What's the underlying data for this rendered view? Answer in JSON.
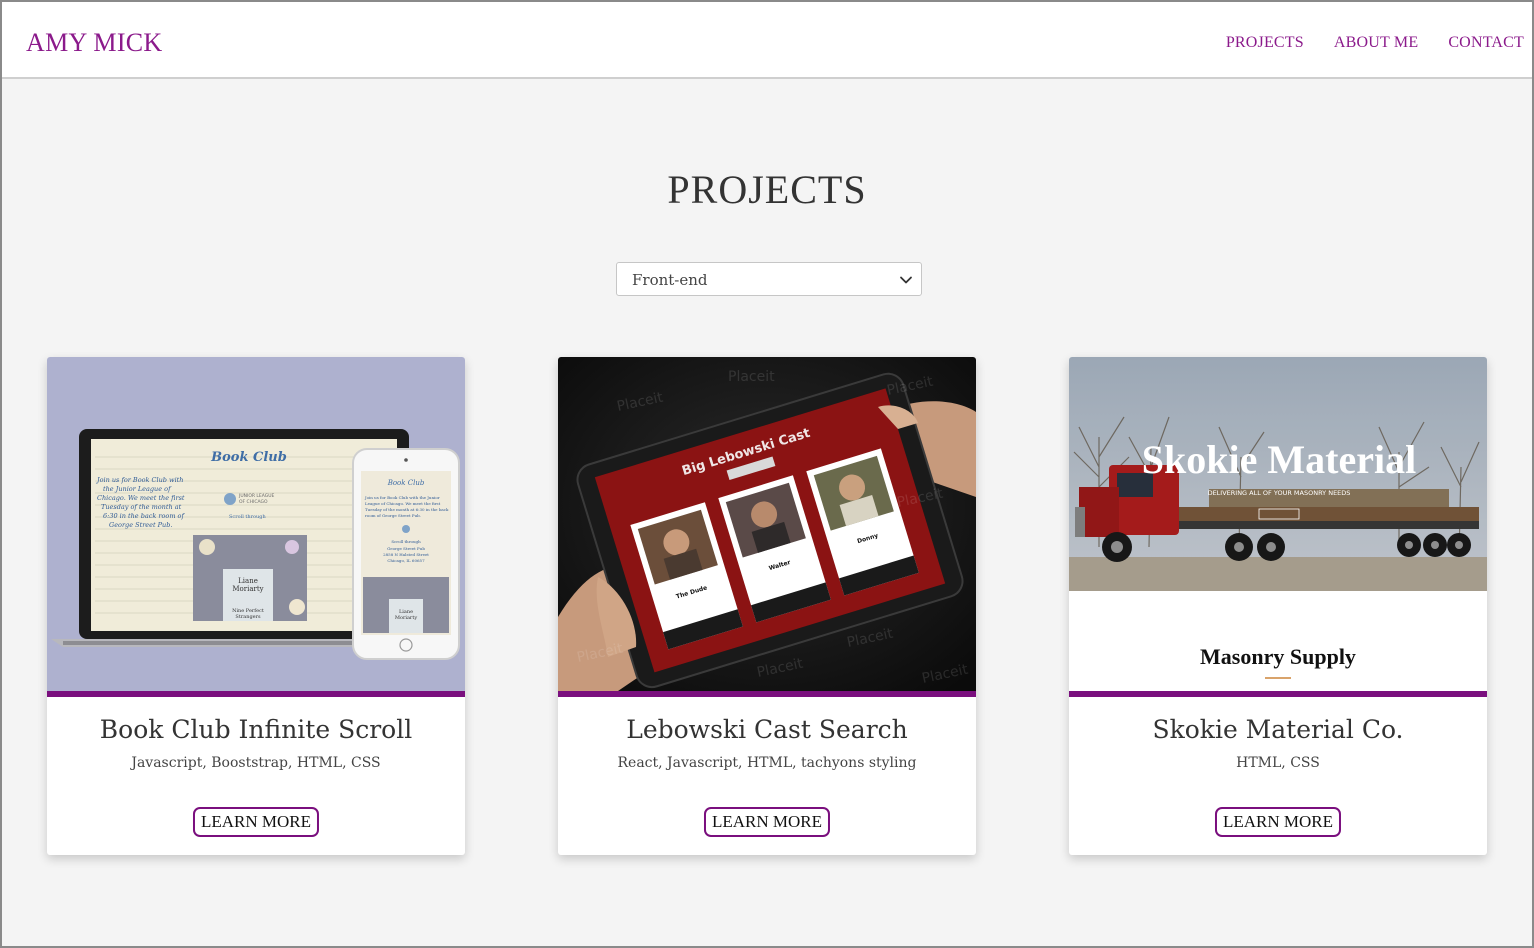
{
  "brand": "AMY MICK",
  "nav": {
    "links": [
      "PROJECTS",
      "ABOUT ME",
      "CONTACT"
    ]
  },
  "page_title": "PROJECTS",
  "filter": {
    "selected": "Front-end"
  },
  "cards": [
    {
      "title": "Book Club Infinite Scroll",
      "tech": "Javascript, Booststrap, HTML, CSS",
      "button": "LEARN MORE",
      "image_text": {
        "screen_title": "Book Club",
        "phone_title": "Book Club",
        "invite": "Join us for Book Club with the Junior League of Chicago. We meet the first Tuesday of the month at 6:30 in the back room of George Street Pub.",
        "book_cover": "Liane Moriarty"
      }
    },
    {
      "title": "Lebowski Cast Search",
      "tech": "React, Javascript, HTML, tachyons styling",
      "button": "LEARN MORE",
      "image_text": {
        "app_title": "Big Lebowski Cast",
        "cards": [
          "The Dude",
          "Walter",
          "Donny"
        ],
        "watermark": "Placeit"
      }
    },
    {
      "title": "Skokie Material Co.",
      "tech": "HTML, CSS",
      "button": "LEARN MORE",
      "image_text": {
        "hero_title": "Skokie Material",
        "hero_subtitle": "DELIVERING ALL OF YOUR MASONRY NEEDS",
        "section_title": "Masonry Supply"
      }
    }
  ],
  "colors": {
    "brand": "#8b1a8b",
    "accent": "#7a0f7e",
    "background": "#f4f4f4"
  },
  "icons": {
    "select": "chevron-down-icon"
  }
}
